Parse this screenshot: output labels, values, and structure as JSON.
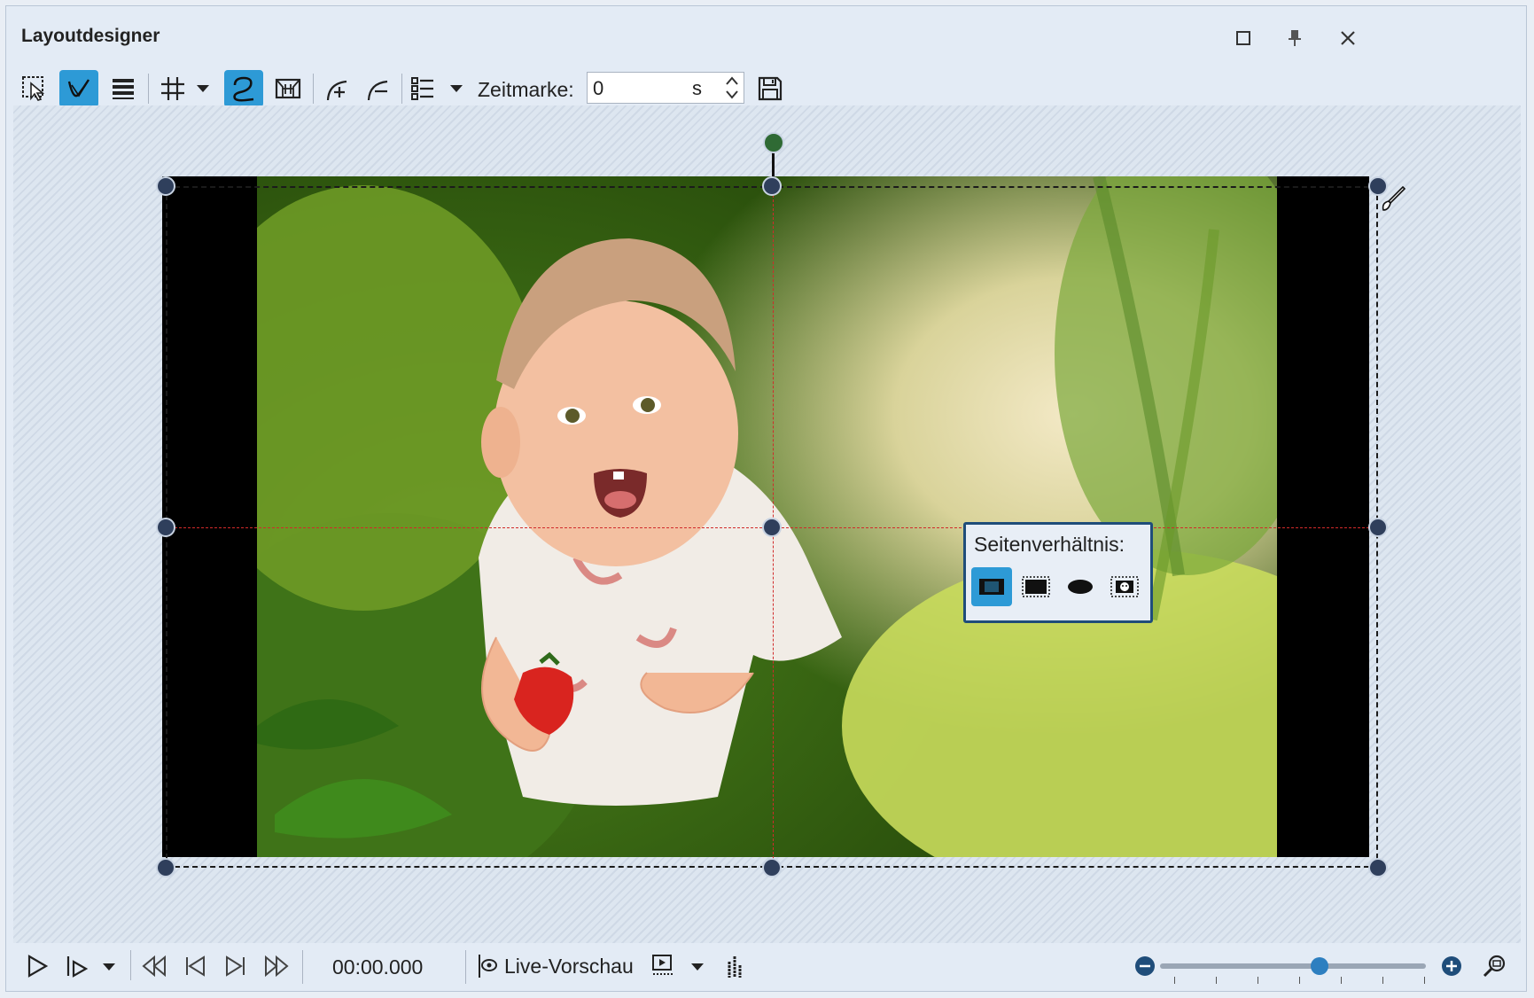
{
  "window": {
    "title": "Layoutdesigner",
    "controls": [
      "maximize-icon",
      "pin-icon",
      "close-icon"
    ]
  },
  "toolbar": {
    "tools": [
      {
        "icon": "select-icon",
        "active": false
      },
      {
        "icon": "edit-path-icon",
        "active": true
      },
      {
        "icon": "layers-icon",
        "active": false
      },
      {
        "icon": "grid-icon",
        "active": false,
        "dropdown": true
      },
      {
        "icon": "motion-path-icon",
        "active": true
      },
      {
        "icon": "camera-frame-icon",
        "active": false
      },
      {
        "icon": "add-curve-point-icon",
        "active": false
      },
      {
        "icon": "remove-curve-point-icon",
        "active": false
      },
      {
        "icon": "list-icon",
        "active": false,
        "dropdown": true
      }
    ],
    "timemark_label": "Zeitmarke:",
    "timemark_value": "0",
    "timemark_unit": "s",
    "save_icon": "save-icon"
  },
  "canvas": {
    "object": "baby-photo",
    "aspect_popup": {
      "title": "Seitenverhältnis:",
      "options": [
        {
          "icon": "fit-icon",
          "active": true
        },
        {
          "icon": "fill-icon",
          "active": false
        },
        {
          "icon": "ellipse-icon",
          "active": false
        },
        {
          "icon": "face-icon",
          "active": false
        }
      ]
    }
  },
  "playback": {
    "time": "00:00.000",
    "live_preview_label": "Live-Vorschau",
    "zoom_level": 0.6
  },
  "colors": {
    "accent": "#2d9ad6",
    "handle": "#2f3f5c",
    "rotate_handle": "#2f6a34",
    "guide": "#d12a2a"
  }
}
